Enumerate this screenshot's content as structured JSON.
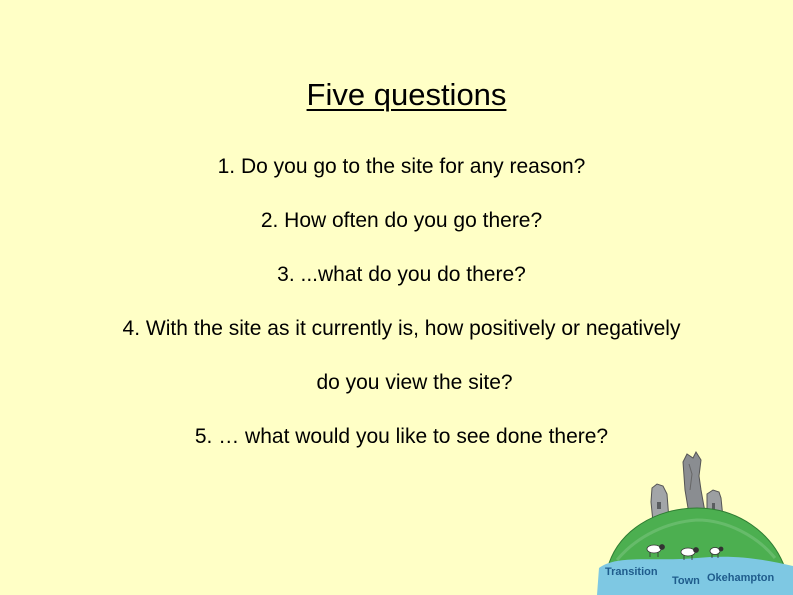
{
  "slide": {
    "title": "Five questions",
    "questions": [
      "1. Do you go to the site for any reason?",
      "2. How often do you go there?",
      "3. ...what do you do there?",
      "4. With the site as it currently is, how positively or negatively",
      "do you view the site?",
      "5. … what would you like to see done there?"
    ]
  },
  "logo": {
    "word1": "Transition",
    "word2": "Town",
    "word3": "Okehampton",
    "colors": {
      "hill": "#4caf50",
      "water": "#7ec8e3",
      "castle": "#9e9e9e",
      "text": "#1f5c8c"
    }
  },
  "colors": {
    "background": "#ffffc6",
    "text": "#000000"
  }
}
